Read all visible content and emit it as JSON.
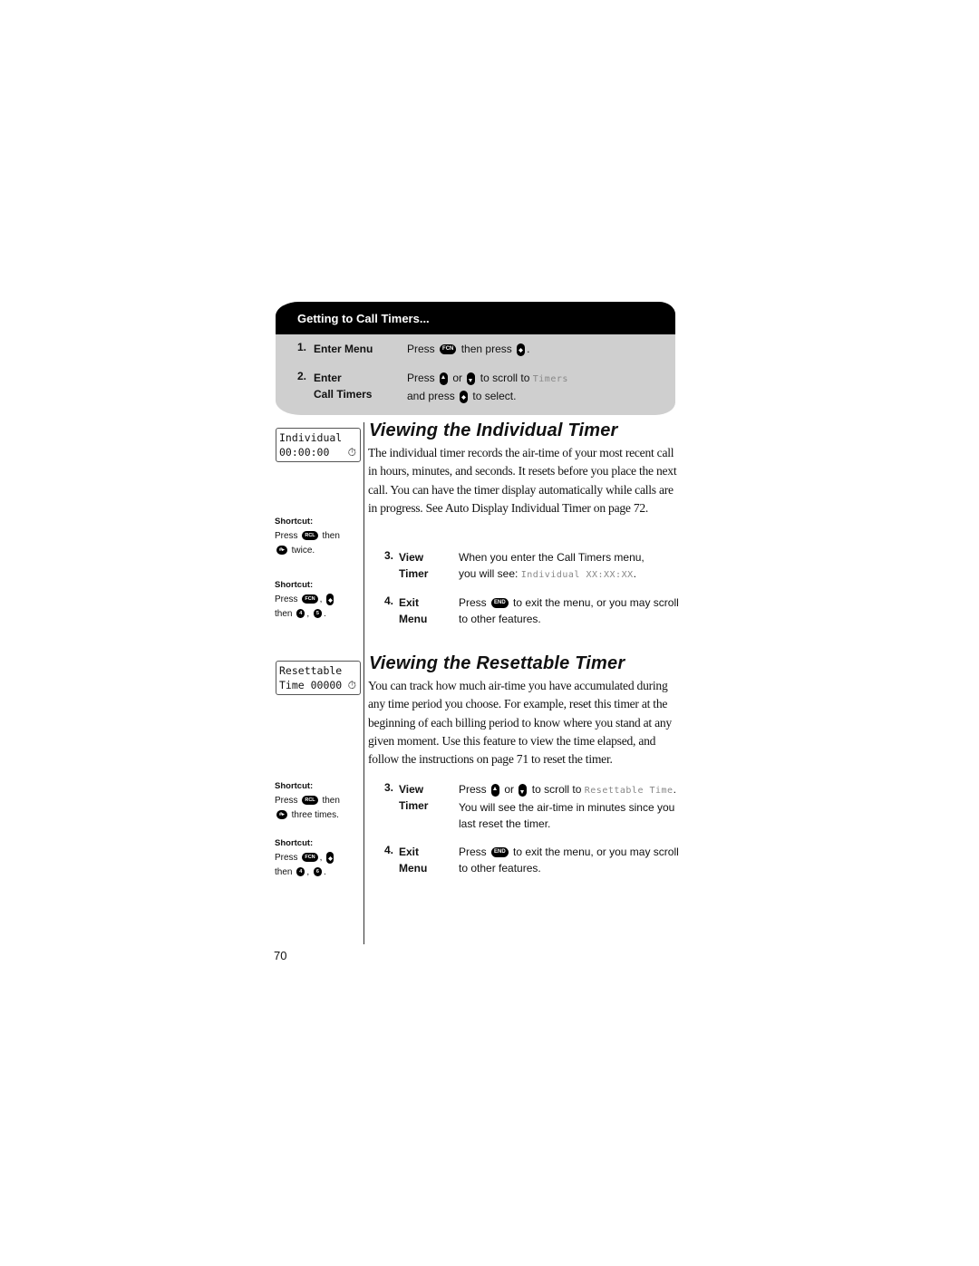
{
  "header": {
    "title": "Getting to Call Timers...",
    "steps": [
      {
        "num": "1.",
        "label_line1": "Enter Menu",
        "label_line2": "",
        "text_parts": [
          "Press",
          "FCN",
          "then press",
          "select-key",
          "."
        ]
      },
      {
        "num": "2.",
        "label_line1": "Enter",
        "label_line2": "Call Timers",
        "line1": {
          "press": "Press",
          "or": "or",
          "scroll": "to scroll to",
          "lcd": "Timers"
        },
        "line2": {
          "press": "and press",
          "select": "to select."
        }
      }
    ]
  },
  "keys": {
    "fcn": "FCN",
    "rcl": "RCL",
    "end": "END",
    "pound": "#▸",
    "four": "4",
    "five": "5",
    "six": "6"
  },
  "individual": {
    "display_line1": "Individual",
    "display_line2": "00:00:00",
    "clock_icon": "⏱",
    "title": "Viewing the Individual Timer",
    "body": "The individual timer records the air-time of your most recent call in hours, minutes, and seconds. It resets before you place the next call. You can have the timer display automatically while calls are in progress. See Auto Display Individual Timer on page 72.",
    "shortcut1": {
      "title": "Shortcut:",
      "press": "Press",
      "then": "then",
      "end": "twice."
    },
    "shortcut2": {
      "title": "Shortcut:",
      "press": "Press",
      "comma": ",",
      "then": "then",
      "comma2": ",",
      "period": "."
    },
    "step3": {
      "num": "3.",
      "l1": "View",
      "l2": "Timer",
      "t1": "When you enter the Call Timers menu,",
      "t2": "you will see:",
      "lcd": "Individual XX:XX:XX",
      "period": "."
    },
    "step4": {
      "num": "4.",
      "l1": "Exit",
      "l2": "Menu",
      "press": "Press",
      "t1": "to exit the menu, or you may scroll",
      "t2": "to other features."
    }
  },
  "resettable": {
    "display_line1": "Resettable",
    "display_line2": "Time 00000",
    "clock_icon": "⏱",
    "title": "Viewing the Resettable Timer",
    "body": "You can track how much air-time you have accumulated during any time period you choose. For example, reset this timer at the beginning of each billing period to know where you stand at any given moment. Use this feature to view the time elapsed, and follow the instructions on page 71 to reset the timer.",
    "shortcut1": {
      "title": "Shortcut:",
      "press": "Press",
      "then": "then",
      "end": "three times."
    },
    "shortcut2": {
      "title": "Shortcut:",
      "press": "Press",
      "comma": ",",
      "then": "then",
      "comma2": ",",
      "period": "."
    },
    "step3": {
      "num": "3.",
      "l1": "View",
      "l2": "Timer",
      "press": "Press",
      "or": "or",
      "scroll": "to scroll to",
      "lcd": "Resettable Time",
      "period": ".",
      "t2": "You will see the air-time in minutes since you",
      "t3": "last reset the timer."
    },
    "step4": {
      "num": "4.",
      "l1": "Exit",
      "l2": "Menu",
      "press": "Press",
      "t1": "to exit the menu, or you may scroll",
      "t2": "to other features."
    }
  },
  "page_number": "70"
}
